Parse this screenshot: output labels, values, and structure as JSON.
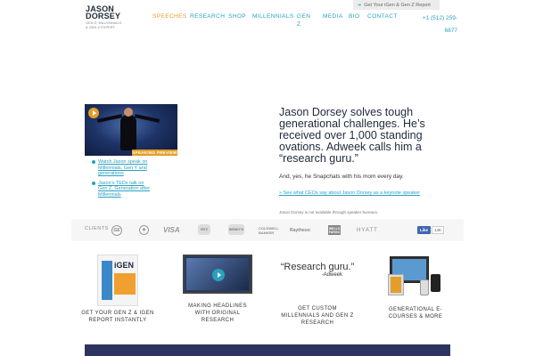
{
  "logo": {
    "name_line1": "JASON",
    "name_line2": "DORSEY",
    "tagline": "GEN Z, MILLENNIALS & GEN Z EXPERT"
  },
  "topbar": {
    "report_link": "Get Your iGen & Gen Z Report"
  },
  "nav": {
    "items": [
      {
        "label": "SPEECHES",
        "active": true
      },
      {
        "label": "RESEARCH",
        "active": false
      },
      {
        "label": "SHOP",
        "active": false
      },
      {
        "label": "MILLENNIALS",
        "active": false
      },
      {
        "label": "GEN Z",
        "active": false
      },
      {
        "label": "MEDIA",
        "active": false
      },
      {
        "label": "BIO",
        "active": false
      },
      {
        "label": "CONTACT",
        "active": false
      }
    ],
    "phone": "+1 (512) 259-6877"
  },
  "hero": {
    "video_tag": "SPEAKING PREVIEW",
    "links": [
      "Watch Jason speak on Millennials, Gen Y and generations",
      "Jason's TEDx talk on Gen Z, Generation after Millennials"
    ],
    "headline": "Jason Dorsey solves tough generational challenges. He’s received over 1,000 standing ovations. Adweek calls him a “research guru.”",
    "subtext": "And, yes, he Snapchats with his mom every day.",
    "ceo_link": "» See what CEOs say about Jason Dorsey as a keynote speaker",
    "note": "Jason Dorsey is not available through speaker bureaus."
  },
  "clients": {
    "label": "CLIENTS",
    "logos": [
      "GE",
      "Mercedes-Benz",
      "VISA",
      "Ritz-Carlton",
      "Wendy's",
      "Coldwell Banker",
      "Raytheon",
      "Wells Fargo",
      "HYATT"
    ],
    "facebook": {
      "like": "Like",
      "count": "14K"
    }
  },
  "cards": [
    {
      "label": "GET YOUR GEN Z & IGEN REPORT INSTANTLY",
      "image_title": "iGEN"
    },
    {
      "label": "MAKING HEADLINES WITH ORIGINAL RESEARCH"
    },
    {
      "label": "GET CUSTOM MILLENNIALS AND GEN Z RESEARCH",
      "quote": "“Research guru.”",
      "quote_source": "-Adweek"
    },
    {
      "label": "GENERATIONAL E-COURSES & MORE"
    }
  ],
  "colors": {
    "accent_orange": "#e39e2a",
    "link_blue": "#2aa0c0",
    "navy": "#2c3560"
  }
}
